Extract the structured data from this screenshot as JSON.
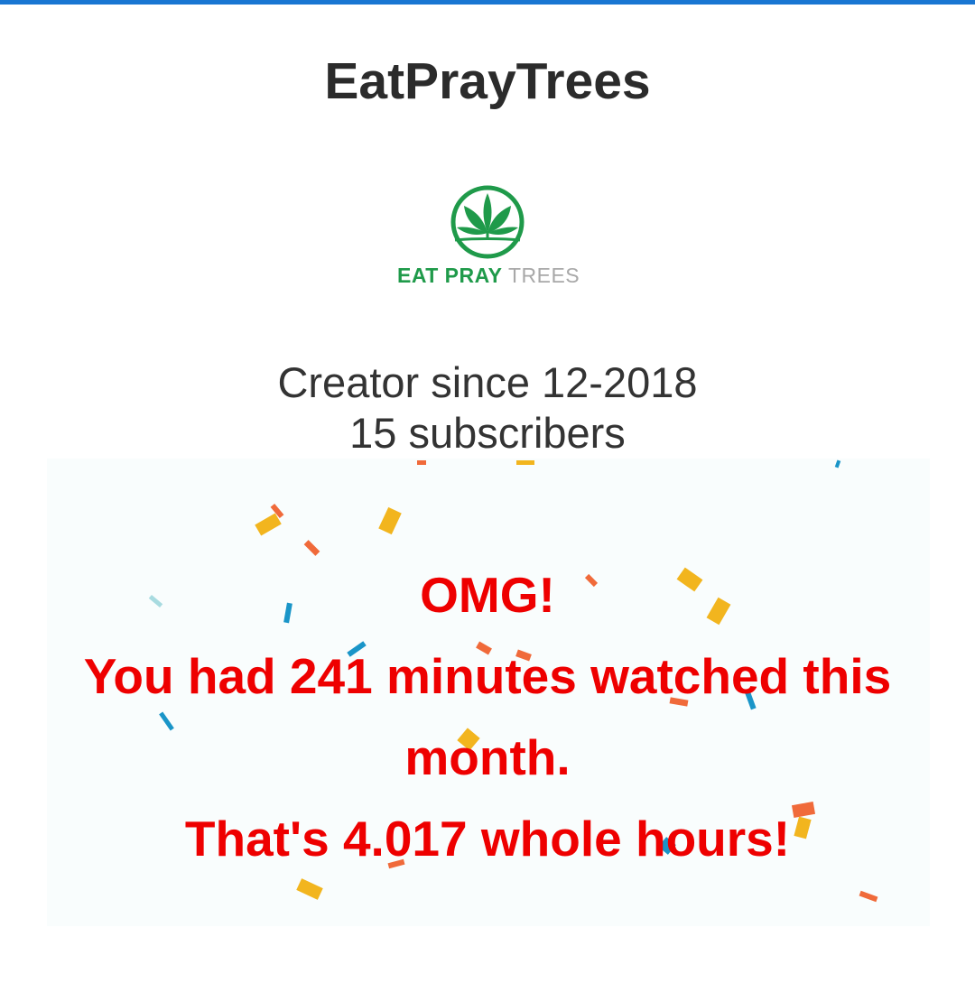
{
  "channel": {
    "title": "EatPrayTrees"
  },
  "logo": {
    "part1": "EAT PRAY",
    "part2": "TREES",
    "icon": "cannabis-leaf-icon",
    "color": "#1f9a4a"
  },
  "creator": {
    "since": "Creator since 12-2018",
    "subscribers": "15 subscribers"
  },
  "celebration": {
    "line1": "OMG!",
    "line2": "You had 241 minutes watched this",
    "line3": "month.",
    "line4": "That's 4.017 whole hours!",
    "color": "#ee0000"
  },
  "theme": {
    "accent": "#1976d2"
  }
}
